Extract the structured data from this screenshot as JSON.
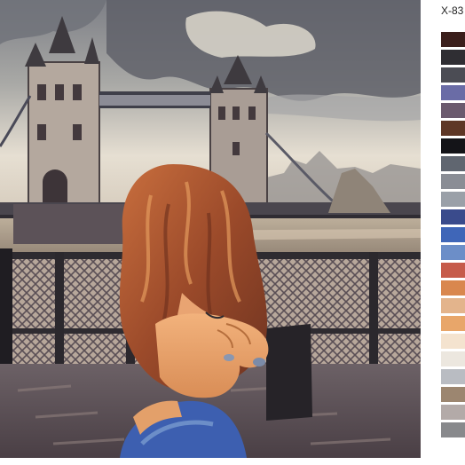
{
  "product_code": "X-83",
  "palette": [
    "#3b1f1c",
    "#2f2e33",
    "#4b4c54",
    "#6a6ca6",
    "#6b5a6e",
    "#5e3726",
    "#141418",
    "#606670",
    "#8a8d95",
    "#9aa0a8",
    "#3a4b8c",
    "#3f66b8",
    "#6c8ec8",
    "#c65b4a",
    "#d9874e",
    "#e3b48c",
    "#e8a66a",
    "#f4e3cf",
    "#ece7df",
    "#b9bcc2",
    "#9c8670",
    "#b3aaa8",
    "#88898c"
  ]
}
